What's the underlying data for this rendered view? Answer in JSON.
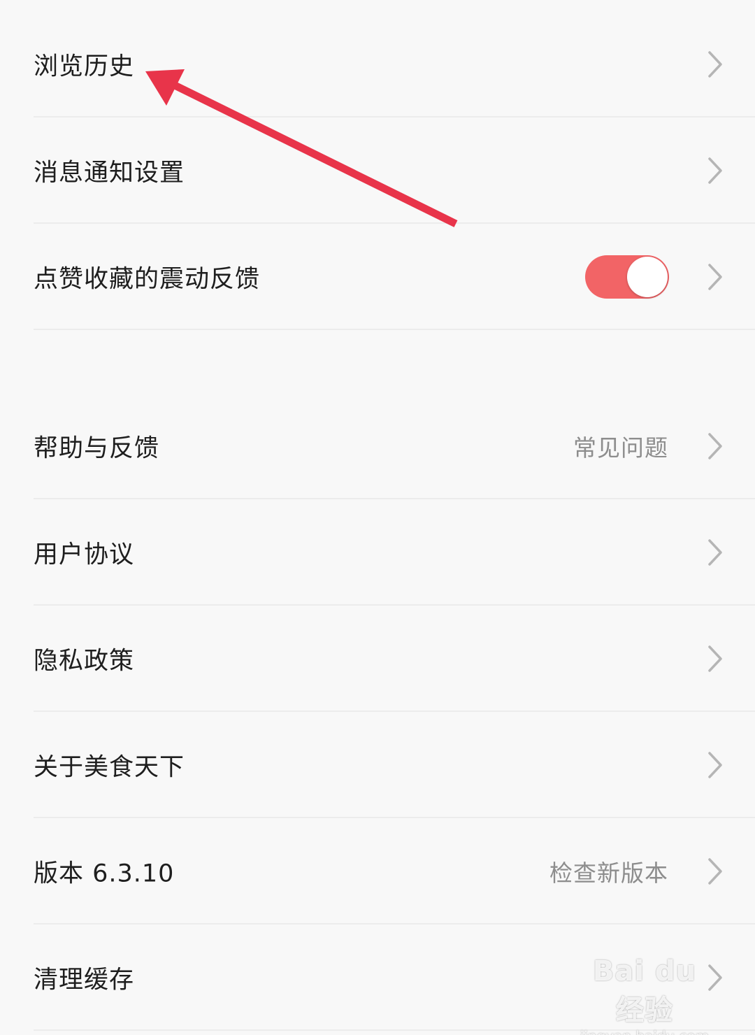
{
  "settings": {
    "items": [
      {
        "label": "浏览历史"
      },
      {
        "label": "消息通知设置"
      },
      {
        "label": "点赞收藏的震动反馈",
        "toggle_on": true
      },
      {
        "label": "帮助与反馈",
        "trailing": "常见问题"
      },
      {
        "label": "用户协议"
      },
      {
        "label": "隐私政策"
      },
      {
        "label": "关于美食天下"
      },
      {
        "label": "版本 6.3.10",
        "trailing": "检查新版本"
      },
      {
        "label": "清理缓存"
      }
    ]
  },
  "watermark": {
    "brand": "Bai du 经验",
    "url": "jingyan.baidu.com"
  },
  "colors": {
    "toggle_on": "#f26466",
    "arrow": "#e8344a"
  }
}
